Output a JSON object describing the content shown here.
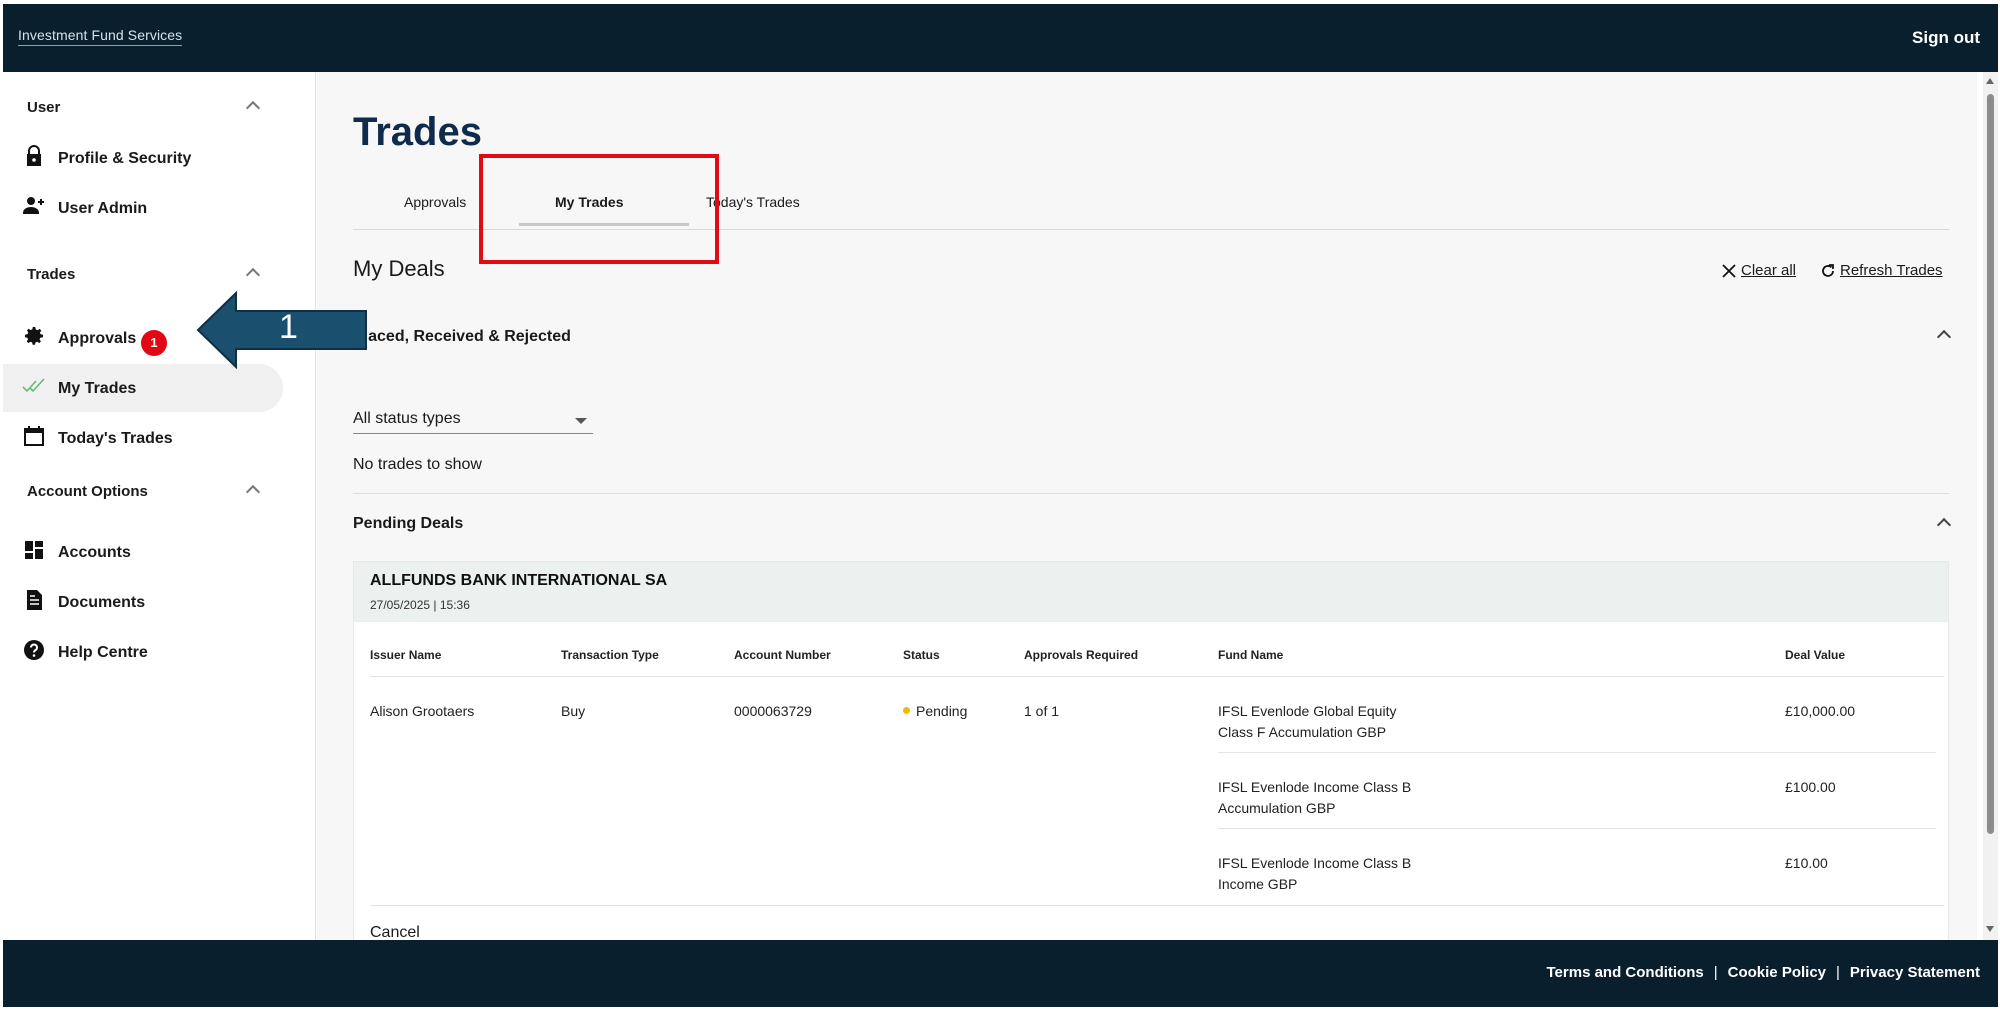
{
  "header": {
    "brand": "Investment Fund Services",
    "sign_out": "Sign out"
  },
  "sidebar": {
    "sections": [
      {
        "title": "User",
        "items": [
          {
            "label": "Profile & Security",
            "icon": "lock-icon"
          },
          {
            "label": "User Admin",
            "icon": "add-user-icon"
          }
        ]
      },
      {
        "title": "Trades",
        "items": [
          {
            "label": "Approvals",
            "icon": "gear-icon",
            "badge": "1"
          },
          {
            "label": "My Trades",
            "icon": "double-check-icon",
            "active": true
          },
          {
            "label": "Today's Trades",
            "icon": "calendar-icon"
          }
        ]
      },
      {
        "title": "Account Options",
        "items": [
          {
            "label": "Accounts",
            "icon": "dashboard-icon"
          },
          {
            "label": "Documents",
            "icon": "document-icon"
          },
          {
            "label": "Help Centre",
            "icon": "help-icon"
          }
        ]
      }
    ]
  },
  "main": {
    "title": "Trades",
    "tabs": [
      {
        "label": "Approvals"
      },
      {
        "label": "My Trades",
        "active": true
      },
      {
        "label": "Today's Trades"
      }
    ],
    "deals_title": "My Deals",
    "actions": {
      "clear_all": "Clear all",
      "refresh": "Refresh Trades"
    },
    "placed_section": {
      "title": "Placed, Received & Rejected",
      "filter_value": "All status types",
      "empty_text": "No trades to show"
    },
    "pending_section": {
      "title": "Pending Deals",
      "card": {
        "company": "ALLFUNDS BANK INTERNATIONAL SA",
        "datetime": "27/05/2025 | 15:36",
        "columns": [
          "Issuer Name",
          "Transaction Type",
          "Account Number",
          "Status",
          "Approvals Required",
          "Fund Name",
          "Deal Value"
        ],
        "row": {
          "issuer": "Alison Grootaers",
          "type": "Buy",
          "account": "0000063729",
          "status": "Pending",
          "approvals": "1 of 1"
        },
        "funds": [
          {
            "line1": "IFSL Evenlode Global Equity",
            "line2": "Class F Accumulation GBP",
            "value": "£10,000.00"
          },
          {
            "line1": "IFSL Evenlode Income Class B",
            "line2": "Accumulation GBP",
            "value": "£100.00"
          },
          {
            "line1": "IFSL Evenlode Income Class B",
            "line2": "Income GBP",
            "value": "£10.00"
          }
        ],
        "cancel": "Cancel"
      }
    }
  },
  "footer": {
    "links": [
      "Terms and Conditions",
      "Cookie Policy",
      "Privacy Statement"
    ],
    "separator": "|"
  },
  "annotation": {
    "arrow_number": "1"
  },
  "colors": {
    "header_bg": "#0a1f2e",
    "title": "#0f2b4c",
    "badge": "#e30613",
    "highlight": "#e20a13",
    "status_pending": "#f5b800",
    "annotation_arrow": "#1b4f6e"
  }
}
